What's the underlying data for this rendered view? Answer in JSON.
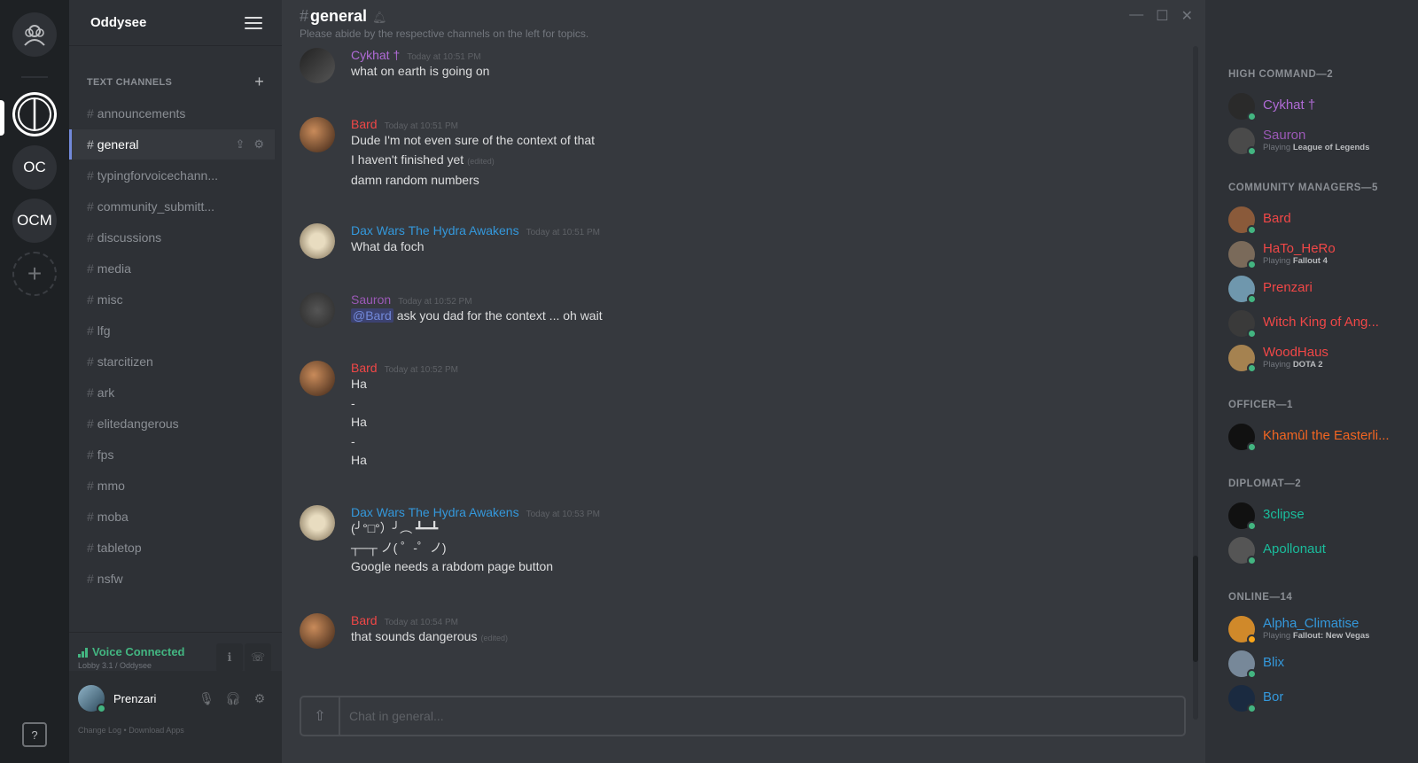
{
  "window": {
    "controls": [
      "—",
      "☐",
      "✕"
    ]
  },
  "rail": {
    "servers": [
      {
        "label": "",
        "icon": "circle-logo"
      },
      {
        "label": "OC"
      },
      {
        "label": "OCM"
      }
    ],
    "add_label": "+",
    "help_label": "?"
  },
  "guild": {
    "name": "Oddysee"
  },
  "channels": {
    "category": "TEXT CHANNELS",
    "add": "+",
    "items": [
      "announcements",
      "general",
      "typingforvoicechann...",
      "community_submitt...",
      "discussions",
      "media",
      "misc",
      "lfg",
      "starcitizen",
      "ark",
      "elitedangerous",
      "fps",
      "mmo",
      "moba",
      "tabletop",
      "nsfw"
    ]
  },
  "voice": {
    "status": "Voice Connected",
    "sub": "Lobby 3.1 / Oddysee"
  },
  "user": {
    "name": "Prenzari",
    "links": "Change Log  •  Download Apps"
  },
  "chat": {
    "channel": "general",
    "topic": "Please abide by the respective channels on the left for topics.",
    "placeholder": "Chat in general...",
    "edited": "(edited)",
    "messages": [
      {
        "author": "Cykhat †",
        "color": "#b06bd6",
        "time": "Today at 10:51 PM",
        "lines": [
          "what on earth is going on"
        ]
      },
      {
        "author": "Bard",
        "color": "#f04747",
        "time": "Today at 10:51 PM",
        "lines": [
          "Dude I'm not even sure of the context of that",
          "I haven't finished yet",
          "damn random numbers"
        ]
      },
      {
        "author": "Dax Wars The Hydra Awakens",
        "color": "#3498db",
        "time": "Today at 10:51 PM",
        "lines": [
          "What da foch"
        ]
      },
      {
        "author": "Sauron",
        "color": "#9b59b6",
        "time": "Today at 10:52 PM",
        "mention": "@Bard",
        "lines": [
          "ask you dad for the context ... oh wait"
        ]
      },
      {
        "author": "Bard",
        "color": "#f04747",
        "time": "Today at 10:52 PM",
        "lines": [
          "Ha",
          "-",
          "Ha",
          "-",
          "Ha"
        ]
      },
      {
        "author": "Dax Wars The Hydra Awakens",
        "color": "#3498db",
        "time": "Today at 10:53 PM",
        "lines": [
          "(╯°□°）╯︵ ┻━┻",
          "┬─┬ ノ( ゜-゜ノ)",
          "Google needs a rabdom page button"
        ]
      },
      {
        "author": "Bard",
        "color": "#f04747",
        "time": "Today at 10:54 PM",
        "lines": [
          "that sounds dangerous"
        ]
      }
    ]
  },
  "members": {
    "groups": [
      {
        "role": "HIGH COMMAND—2",
        "items": [
          {
            "name": "Cykhat †",
            "color": "#b06bd6"
          },
          {
            "name": "Sauron",
            "color": "#9b59b6",
            "playing": "League of Legends"
          }
        ]
      },
      {
        "role": "COMMUNITY MANAGERS—5",
        "items": [
          {
            "name": "Bard",
            "color": "#f04747"
          },
          {
            "name": "HaTo_HeRo",
            "color": "#f04747",
            "playing": "Fallout 4"
          },
          {
            "name": "Prenzari",
            "color": "#f04747"
          },
          {
            "name": "Witch King of Ang...",
            "color": "#f04747"
          },
          {
            "name": "WoodHaus",
            "color": "#f04747",
            "playing": "DOTA 2"
          }
        ]
      },
      {
        "role": "OFFICER—1",
        "items": [
          {
            "name": "Khamûl the Easterli...",
            "color": "#f26522"
          }
        ]
      },
      {
        "role": "DIPLOMAT—2",
        "items": [
          {
            "name": "3clipse",
            "color": "#1abc9c"
          },
          {
            "name": "Apollonaut",
            "color": "#1abc9c"
          }
        ]
      },
      {
        "role": "ONLINE—14",
        "items": [
          {
            "name": "Alpha_Climatise",
            "color": "#3498db",
            "playing": "Fallout: New Vegas"
          },
          {
            "name": "Blix",
            "color": "#3498db"
          },
          {
            "name": "Bor",
            "color": "#3498db"
          }
        ]
      }
    ],
    "playing_prefix": "Playing"
  }
}
